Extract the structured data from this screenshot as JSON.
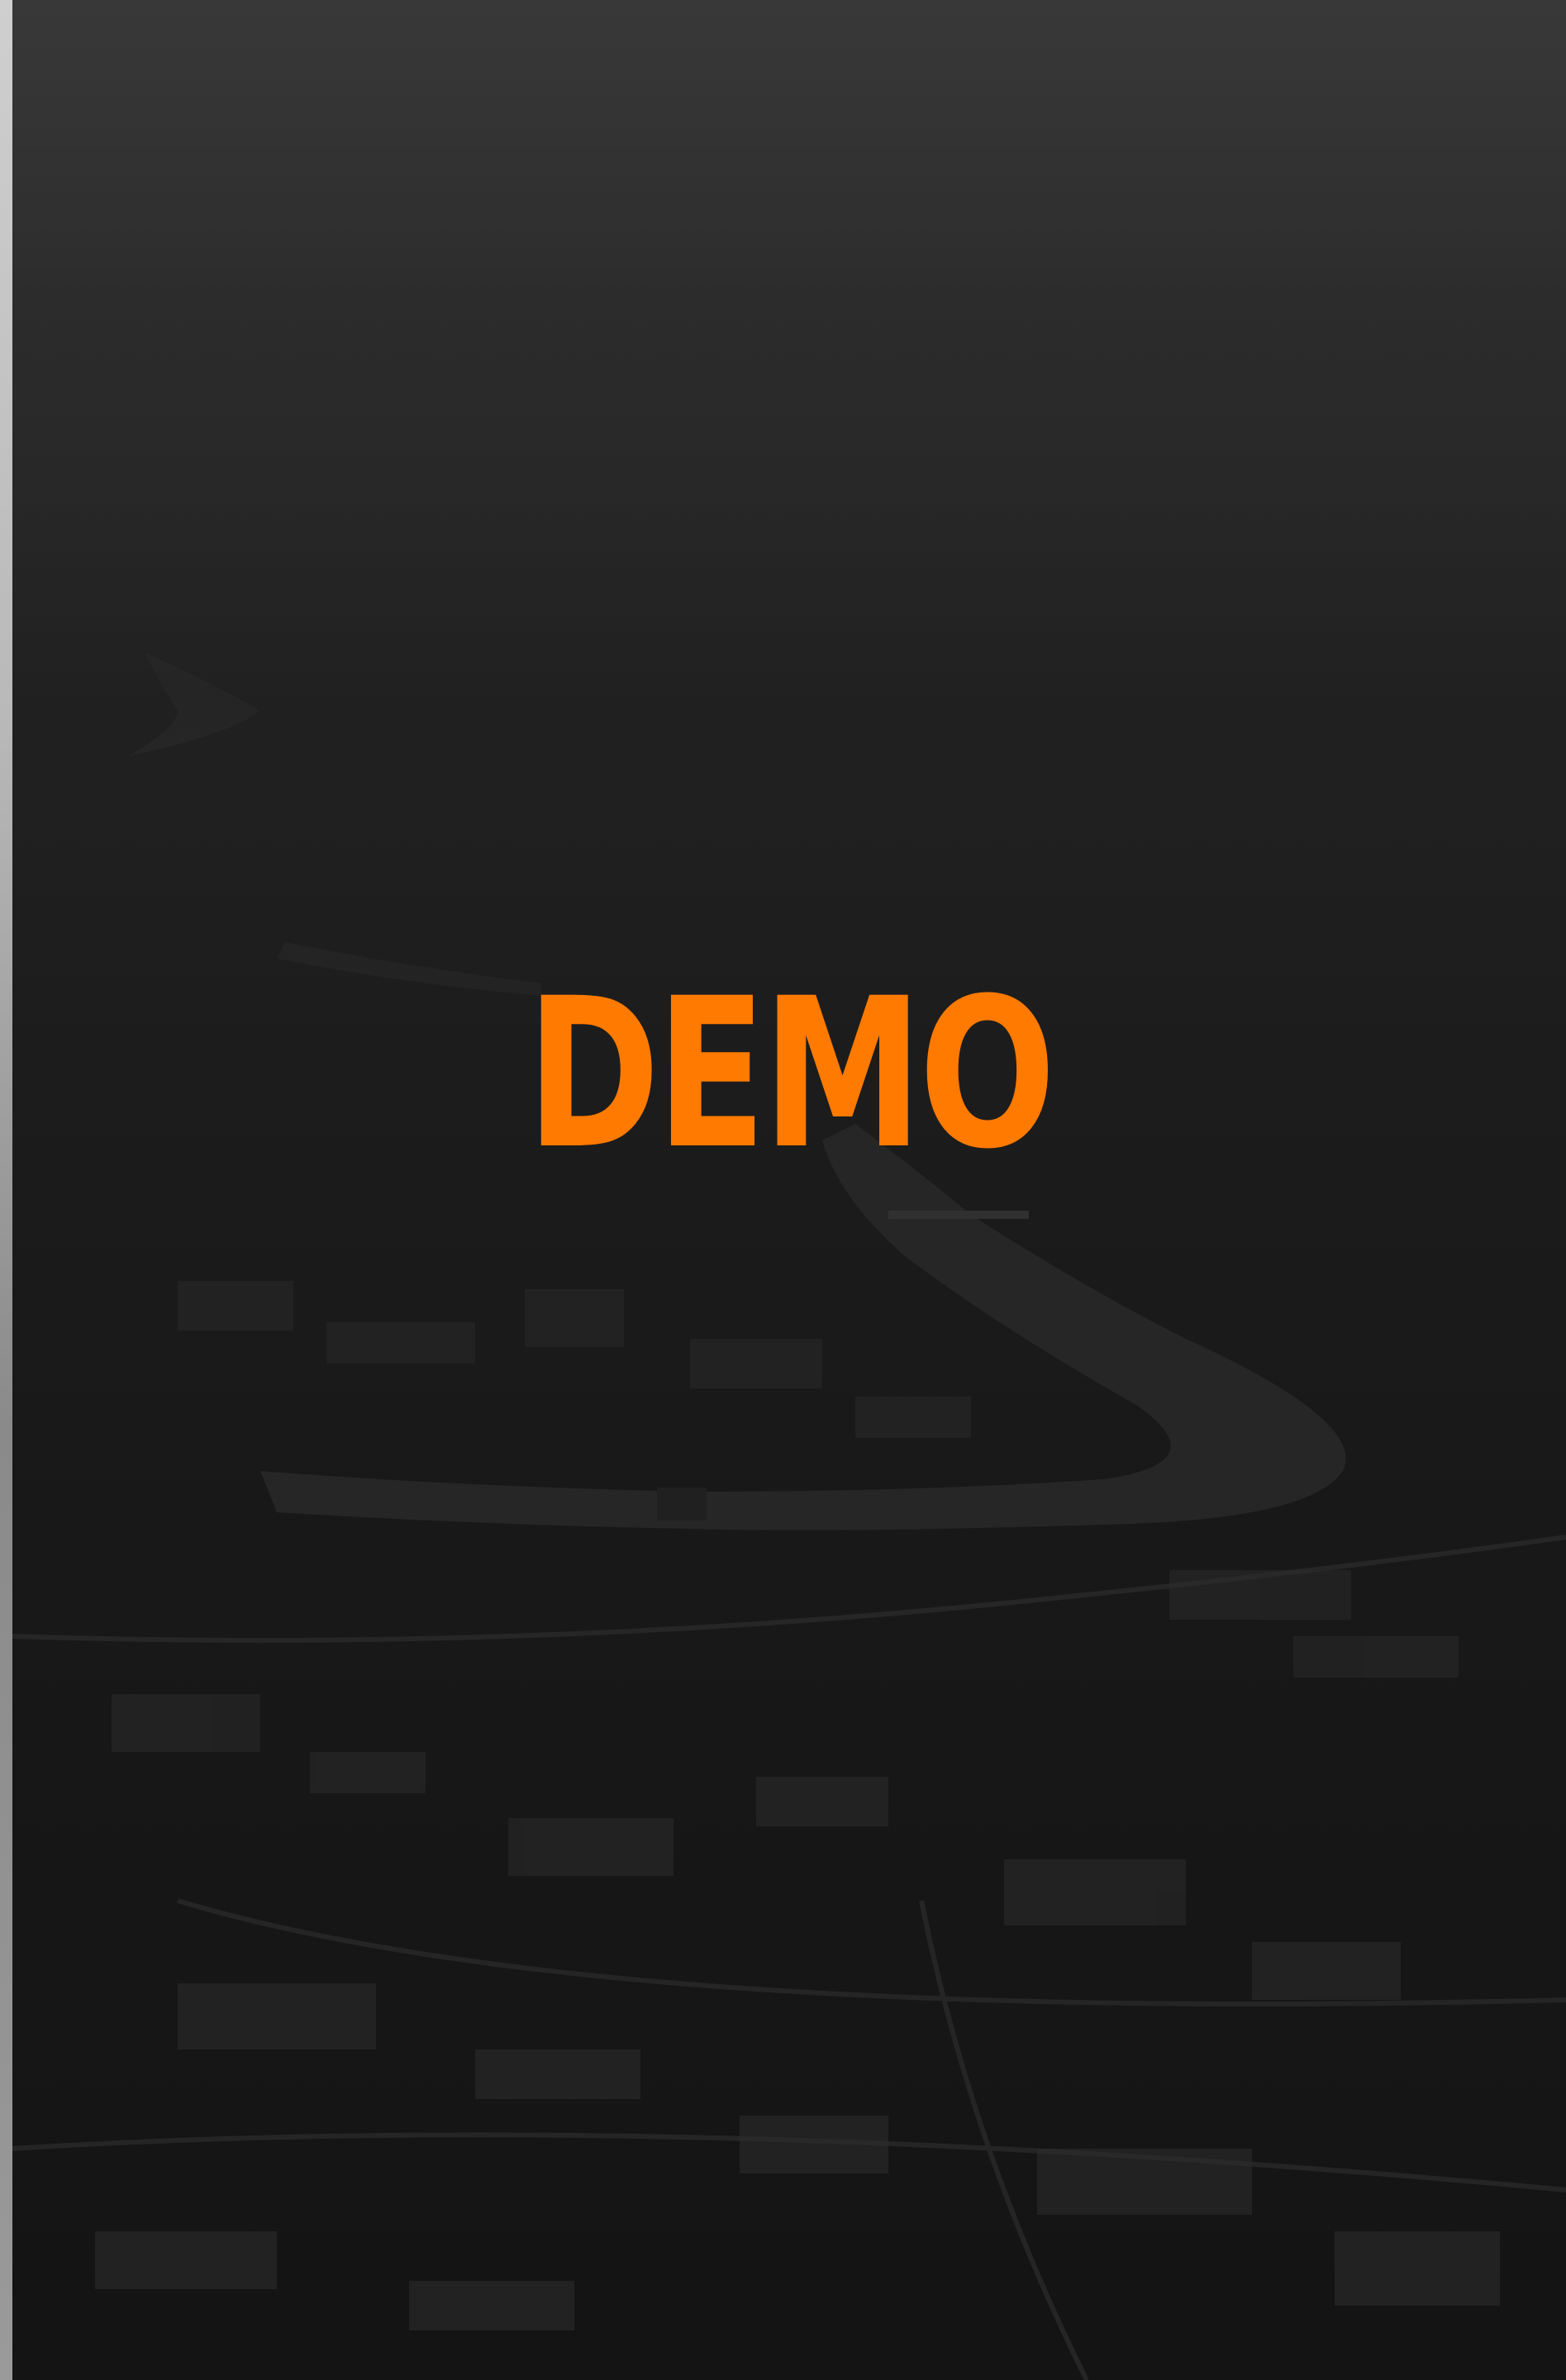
{
  "hero": {
    "title": "DEMO",
    "background_image": "aerial-city-river-photo"
  },
  "colors": {
    "accent": "#ff7a00",
    "background": "#1b1b1b",
    "river": "#262626"
  }
}
